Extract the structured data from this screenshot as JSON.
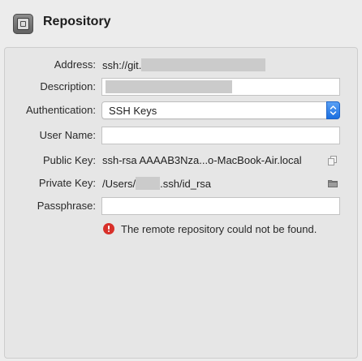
{
  "header": {
    "title": "Repository",
    "icon": "repository-icon"
  },
  "form": {
    "address": {
      "label": "Address:",
      "value_prefix": "ssh://git."
    },
    "description": {
      "label": "Description:"
    },
    "authentication": {
      "label": "Authentication:",
      "selected": "SSH Keys"
    },
    "user_name": {
      "label": "User Name:",
      "value": ""
    },
    "public_key": {
      "label": "Public Key:",
      "value": "ssh-rsa AAAAB3Nza...o-MacBook-Air.local",
      "icon": "copy-icon"
    },
    "private_key": {
      "label": "Private Key:",
      "value_prefix": "/Users/",
      "value_suffix": ".ssh/id_rsa",
      "icon": "folder-icon"
    },
    "passphrase": {
      "label": "Passphrase:",
      "value": ""
    }
  },
  "error": {
    "message": "The remote repository could not be found.",
    "color": "#d8302a"
  },
  "colors": {
    "accent": "#1a6fe0",
    "background": "#ececec"
  }
}
